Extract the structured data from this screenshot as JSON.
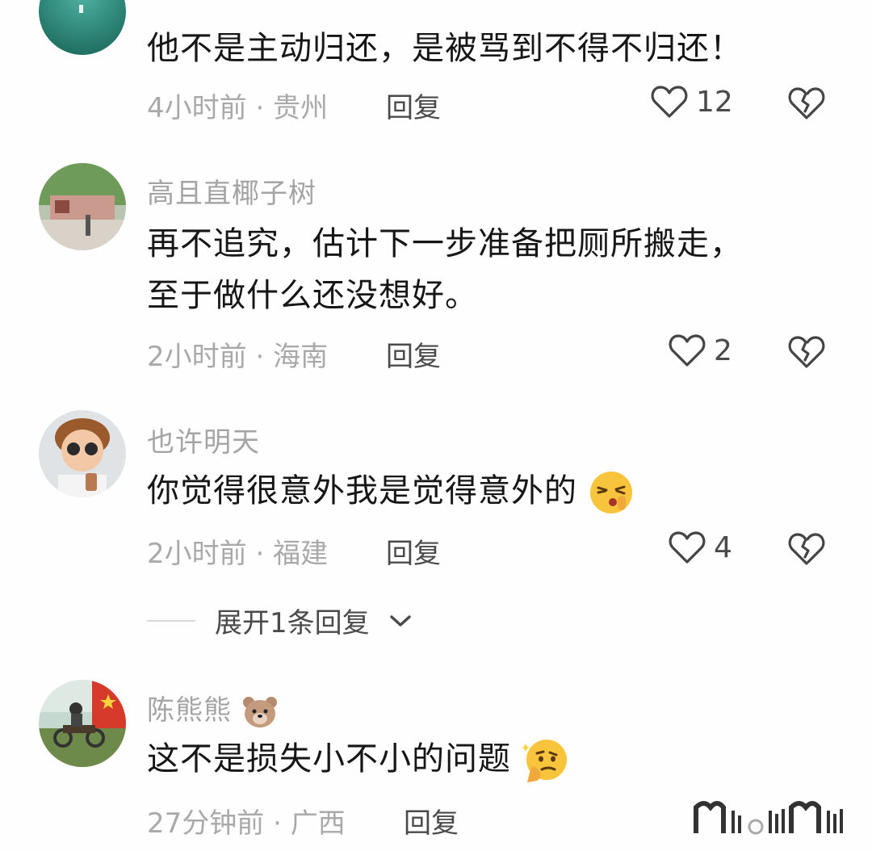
{
  "comments": [
    {
      "username": "",
      "text_lines": [
        "他不是主动归还，是被骂到不得不归还！"
      ],
      "time": "4小时前",
      "location": "贵州",
      "reply_label": "回复",
      "likes": "12"
    },
    {
      "username": "高且直椰子树",
      "text_lines": [
        "再不追究，估计下一步准备把厕所搬走，",
        "至于做什么还没想好。"
      ],
      "time": "2小时前",
      "location": "海南",
      "reply_label": "回复",
      "likes": "2"
    },
    {
      "username": "也许明天",
      "text_lines": [
        "你觉得很意外我是觉得意外的"
      ],
      "time": "2小时前",
      "location": "福建",
      "reply_label": "回复",
      "likes": "4",
      "expand_label": "展开1条回复"
    },
    {
      "username": "陈熊熊",
      "text_lines": [
        "这不是损失小不小的问题"
      ],
      "time": "27分钟前",
      "location": "广西",
      "reply_label": "回复"
    }
  ],
  "separator": "·",
  "icons": {
    "like": "heart-outline-icon",
    "dislike": "broken-heart-icon",
    "expand": "chevron-down-icon",
    "emoji_3": "shushing-face-emoji",
    "emoji_4": "thinking-face-emoji",
    "username_emoji_4": "bear-face-emoji"
  }
}
